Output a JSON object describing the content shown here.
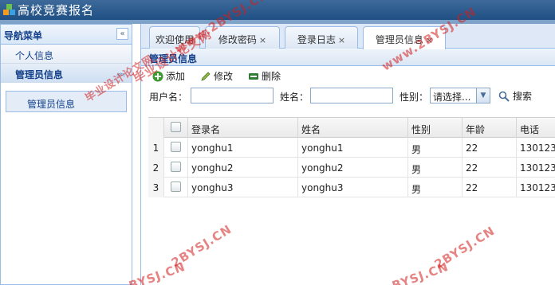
{
  "app": {
    "title": "高校竞赛报名"
  },
  "sidebar": {
    "title": "导航菜单",
    "collapse_glyph": "«",
    "items": [
      {
        "label": "个人信息"
      },
      {
        "label": "管理员信息",
        "caret": "︽"
      }
    ],
    "links": [
      {
        "label": "管理员信息"
      }
    ]
  },
  "tabs": [
    {
      "label": "欢迎使用",
      "close": ""
    },
    {
      "label": "修改密码",
      "close": "×"
    },
    {
      "label": "登录日志",
      "close": "×"
    },
    {
      "label": "管理员信息",
      "close": "×"
    }
  ],
  "panel": {
    "title": "管理员信息"
  },
  "toolbar": {
    "add": "添加",
    "edit": "修改",
    "delete": "删除"
  },
  "search": {
    "username_label": "用户名：",
    "username_value": "",
    "name_label": "姓名：",
    "name_value": "",
    "gender_label": "性别：",
    "gender_selected": "请选择...",
    "button": "搜索"
  },
  "grid": {
    "columns": [
      "登录名",
      "姓名",
      "性别",
      "年龄",
      "电话"
    ],
    "rows": [
      {
        "num": "1",
        "login": "yonghu1",
        "name": "yonghu1",
        "gender": "男",
        "age": "22",
        "phone": "130123"
      },
      {
        "num": "2",
        "login": "yonghu2",
        "name": "yonghu2",
        "gender": "男",
        "age": "22",
        "phone": "130123"
      },
      {
        "num": "3",
        "login": "yonghu3",
        "name": "yonghu3",
        "gender": "男",
        "age": "22",
        "phone": "130123"
      }
    ]
  },
  "watermarks": [
    "www.2BYSJ.CN",
    "毕业设计论文网",
    "www.2BYSJ.CN",
    "毕业设计论文网",
    "2BYSJ.CN",
    "2BYSJ.CN",
    "BYSJ.CN",
    "BYSJ.CN"
  ],
  "colors": {
    "accent": "#15428b",
    "border": "#99bbe8",
    "banner": "#2a5a8f",
    "watermark": "#d21e1e"
  }
}
